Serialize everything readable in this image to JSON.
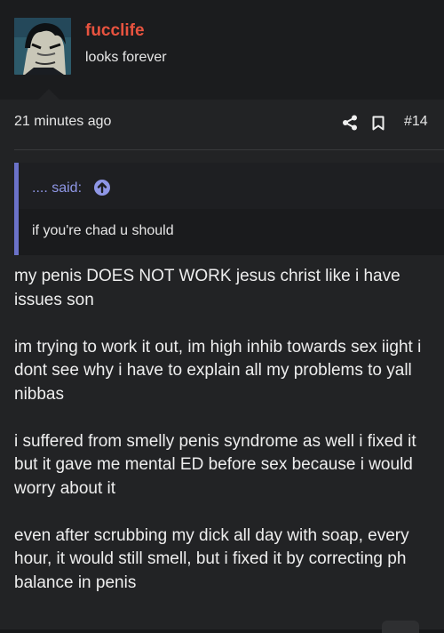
{
  "post": {
    "username": "fucclife",
    "user_title": "looks forever",
    "time": "21 minutes ago",
    "number": "#14",
    "icons": {
      "share": "share-icon",
      "bookmark": "bookmark-icon",
      "quote_up": "arrow-up-circle-icon"
    },
    "quote": {
      "author": ".... said:",
      "text": "if you're chad u should"
    },
    "paragraphs": [
      "my penis DOES NOT WORK jesus christ like i have issues son",
      "im trying to work it out, im high inhib towards sex iight i dont see why i have to explain all my problems to yall nibbas",
      "i suffered from smelly penis syndrome as well i fixed it but it gave me mental ED before sex because i would worry about it",
      "even after scrubbing my dick all day with soap, every hour, it would still smell, but i fixed it by correcting ph balance in penis"
    ]
  },
  "colors": {
    "username": "#e8533f",
    "quote_accent": "#6b72c9",
    "quote_author": "#8f97e6",
    "background": "#222325"
  }
}
